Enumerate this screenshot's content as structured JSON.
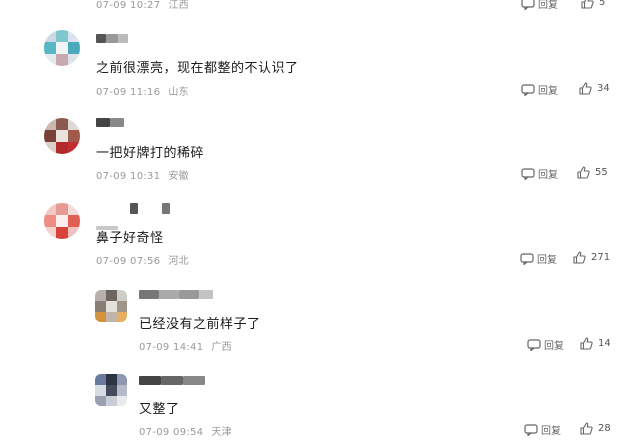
{
  "reply_label": "回复",
  "comments": [
    {
      "time": "07-09 10:27",
      "location": "江西",
      "text": "",
      "likes": "5"
    },
    {
      "time": "07-09 11:16",
      "location": "山东",
      "text": "之前很漂亮，现在都整的不认识了",
      "likes": "34"
    },
    {
      "time": "07-09 10:31",
      "location": "安徽",
      "text": "一把好牌打的稀碎",
      "likes": "55"
    },
    {
      "time": "07-09 07:56",
      "location": "河北",
      "text": "鼻子好奇怪",
      "likes": "271"
    },
    {
      "time": "07-09 14:41",
      "location": "广西",
      "text": "已经没有之前样子了",
      "likes": "14"
    },
    {
      "time": "07-09 09:54",
      "location": "天津",
      "text": "又整了",
      "likes": "28"
    }
  ]
}
